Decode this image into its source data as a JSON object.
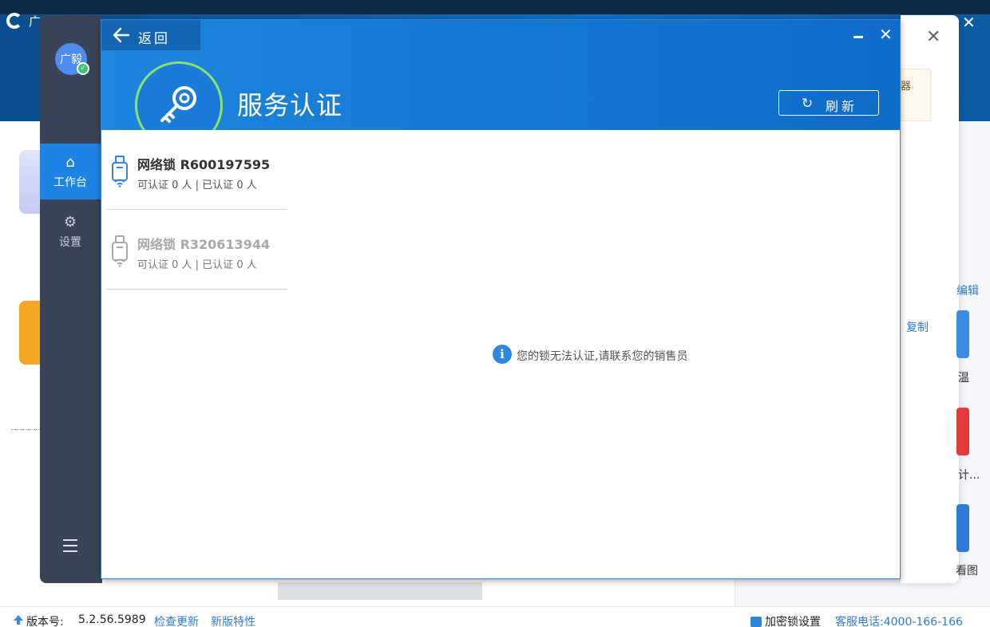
{
  "background": {
    "app_title": "广",
    "close_glyph": "✕",
    "dialog_close_glyph": "✕",
    "notice_text": "器",
    "link_edit": "编辑",
    "link_copy": "复制",
    "item1_label": "温",
    "item2_label": "计...",
    "item3_label": "看图"
  },
  "statusbar": {
    "version_label": "版本号:",
    "version_value": "5.2.56.5989",
    "check_update": "检查更新",
    "new_features": "新版特性",
    "lock_settings": "加密锁设置",
    "service_phone": "客服电话:4000-166-166"
  },
  "sidebar": {
    "avatar_text": "广毅",
    "badge_glyph": "✓",
    "items": [
      {
        "label": "工作台",
        "icon": "home-icon",
        "glyph": "⌂",
        "active": true
      },
      {
        "label": "设置",
        "icon": "gear-icon",
        "glyph": "⚙",
        "active": false
      }
    ],
    "menu_icon": "hamburger-menu-icon"
  },
  "header": {
    "back_label": "返回",
    "title": "服务认证",
    "refresh_glyph": "↻",
    "refresh_label": "刷新",
    "close_glyph": "✕"
  },
  "locks": [
    {
      "name": "网络锁 R600197595",
      "stats": "可认证 0 人 | 已认证 0 人",
      "active": true
    },
    {
      "name": "网络锁 R320613944",
      "stats": "可认证 0 人 | 已认证 0 人",
      "active": false
    }
  ],
  "message": {
    "icon_glyph": "i",
    "text": "您的锁无法认证,请联系您的销售员"
  },
  "colors": {
    "header_blue": "#1478d4",
    "sidebar_dark": "#3a4458",
    "active_nav": "#1e84e4",
    "key_ring": "#8be36b",
    "usb_active": "#2f86e3",
    "usb_inactive": "#a6a8ab"
  }
}
